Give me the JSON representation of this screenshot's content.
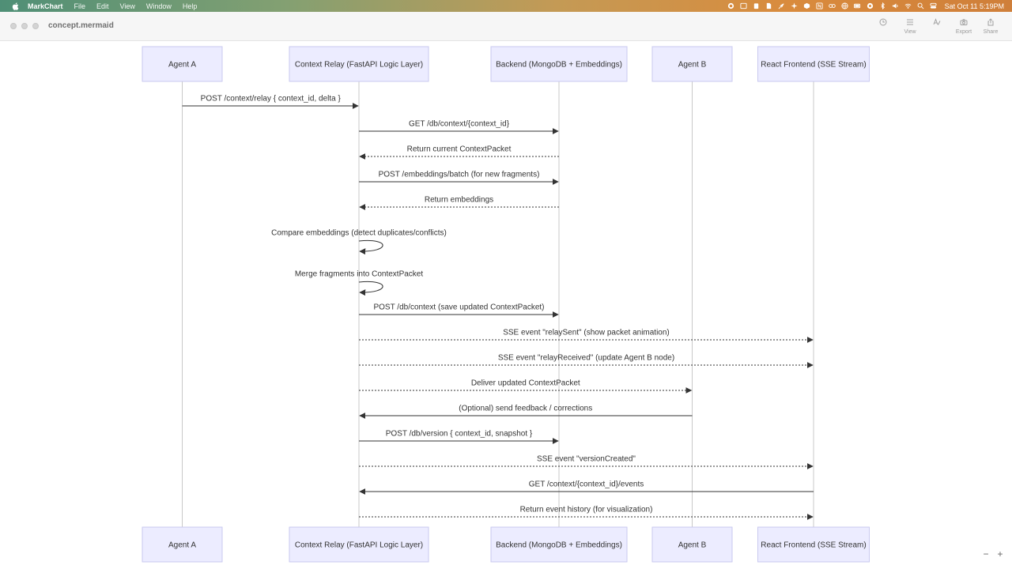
{
  "menubar": {
    "app_name": "MarkChart",
    "items": [
      "File",
      "Edit",
      "View",
      "Window",
      "Help"
    ],
    "clock": "Sat Oct 11  5:19PM",
    "status_icons": [
      "record-icon",
      "screen-icon",
      "clipboard-icon",
      "document-icon",
      "feather-icon",
      "sparkle-icon",
      "cube-icon",
      "notion-icon",
      "link-icon",
      "globe-icon",
      "battery-icon",
      "focus-icon",
      "bluetooth-icon",
      "volume-icon",
      "wifi-icon",
      "search-icon",
      "control-center-icon"
    ]
  },
  "window": {
    "title": "concept.mermaid",
    "toolbar": [
      {
        "name": "history",
        "label": ""
      },
      {
        "name": "view",
        "label": "View"
      },
      {
        "name": "text",
        "label": ""
      },
      {
        "name": "camera",
        "label": "Export"
      },
      {
        "name": "share",
        "label": "Share"
      }
    ]
  },
  "diagram": {
    "actors": [
      {
        "id": "A",
        "label": "Agent A"
      },
      {
        "id": "R",
        "label": "Context Relay (FastAPI Logic Layer)"
      },
      {
        "id": "D",
        "label": "Backend (MongoDB + Embeddings)"
      },
      {
        "id": "B",
        "label": "Agent B"
      },
      {
        "id": "F",
        "label": "React Frontend (SSE Stream)"
      }
    ],
    "messages": [
      {
        "from": "A",
        "to": "R",
        "text": "POST /context/relay { context_id, delta }",
        "style": "solid"
      },
      {
        "from": "R",
        "to": "D",
        "text": "GET /db/context/{context_id}",
        "style": "solid"
      },
      {
        "from": "D",
        "to": "R",
        "text": "Return current ContextPacket",
        "style": "dotted"
      },
      {
        "from": "R",
        "to": "D",
        "text": "POST /embeddings/batch (for new fragments)",
        "style": "solid"
      },
      {
        "from": "D",
        "to": "R",
        "text": "Return embeddings",
        "style": "dotted"
      },
      {
        "from": "R",
        "to": "R",
        "text": "Compare embeddings (detect duplicates/conflicts)",
        "style": "solid"
      },
      {
        "from": "R",
        "to": "R",
        "text": "Merge fragments into ContextPacket",
        "style": "solid"
      },
      {
        "from": "R",
        "to": "D",
        "text": "POST /db/context (save updated ContextPacket)",
        "style": "solid"
      },
      {
        "from": "R",
        "to": "F",
        "text": "SSE event \"relaySent\" (show packet animation)",
        "style": "dotted"
      },
      {
        "from": "R",
        "to": "F",
        "text": "SSE event \"relayReceived\" (update Agent B node)",
        "style": "dotted"
      },
      {
        "from": "R",
        "to": "B",
        "text": "Deliver updated ContextPacket",
        "style": "dotted"
      },
      {
        "from": "B",
        "to": "R",
        "text": "(Optional) send feedback / corrections",
        "style": "solid"
      },
      {
        "from": "R",
        "to": "D",
        "text": "POST /db/version { context_id, snapshot }",
        "style": "solid"
      },
      {
        "from": "R",
        "to": "F",
        "text": "SSE event \"versionCreated\"",
        "style": "dotted"
      },
      {
        "from": "F",
        "to": "R",
        "text": "GET /context/{context_id}/events",
        "style": "solid"
      },
      {
        "from": "R",
        "to": "F",
        "text": "Return event history (for visualization)",
        "style": "dotted"
      }
    ]
  },
  "zoom": {
    "out_label": "−",
    "in_label": "+"
  }
}
